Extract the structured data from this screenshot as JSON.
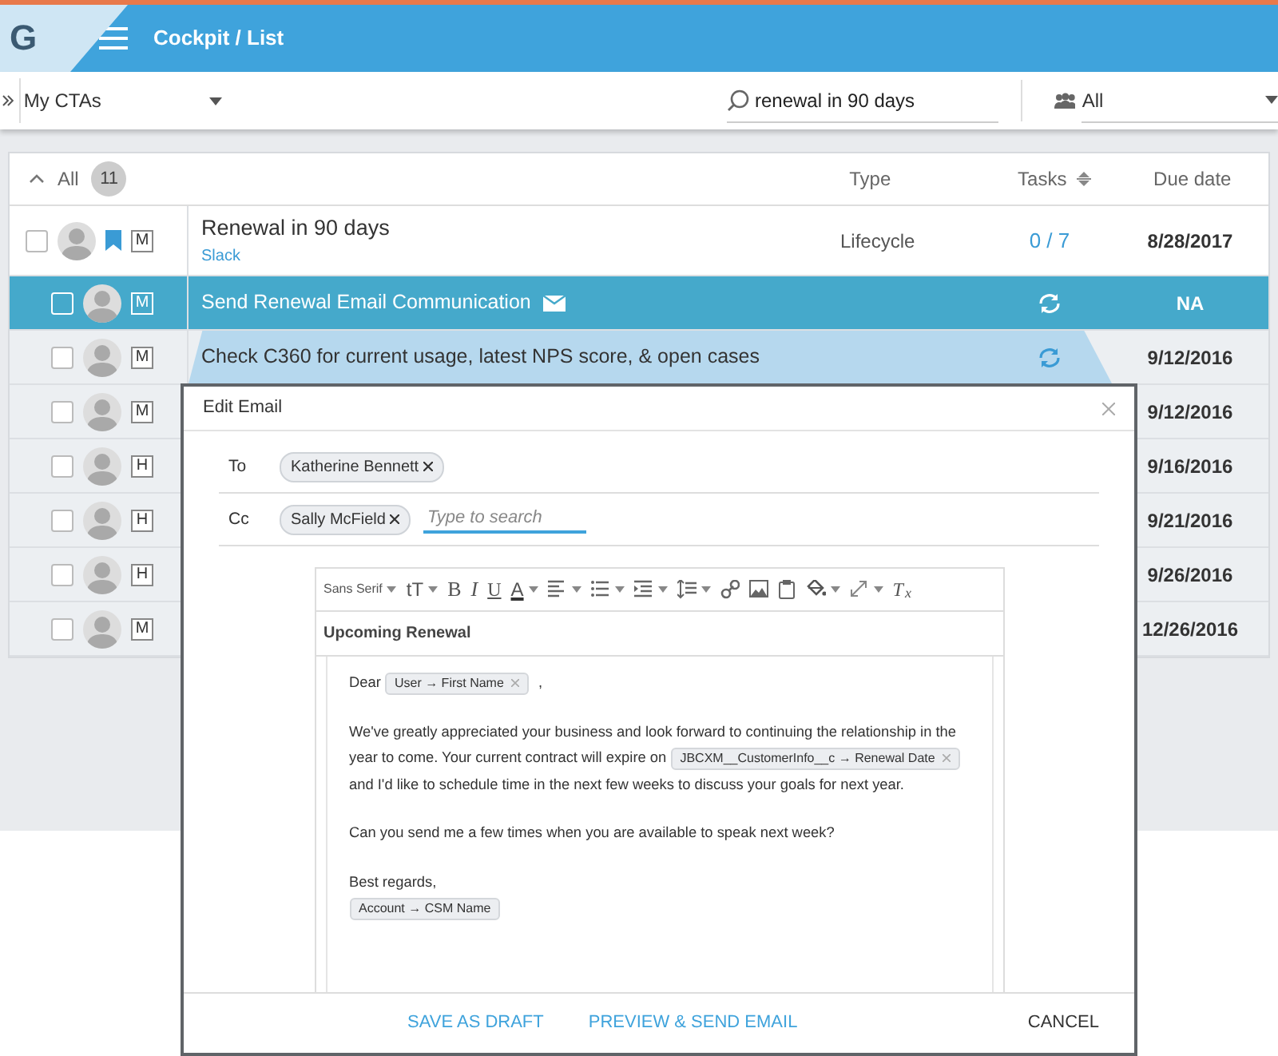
{
  "header": {
    "logo": "G",
    "breadcrumb": "Cockpit / List"
  },
  "filters": {
    "cta_select": "My CTAs",
    "search": "renewal in 90 days",
    "owner_select": "All"
  },
  "list": {
    "group_label": "All",
    "count": "11",
    "expanded": true,
    "columns": [
      "Type",
      "Tasks",
      "Due date"
    ],
    "rows": [
      {
        "kind": "cta",
        "title": "Renewal in 90 days",
        "subtitle": "Slack",
        "type": "Lifecycle",
        "tasks": "0 / 7",
        "due": "8/28/2017",
        "priority": "M",
        "checked": false,
        "bookmarked": true,
        "selected": false,
        "expanded": false,
        "email": false,
        "recurring": false
      },
      {
        "kind": "task",
        "title": "Send Renewal Email Communication",
        "due": "NA",
        "priority": "M",
        "checked": false,
        "bookmarked": false,
        "selected": true,
        "expanded": false,
        "email": true,
        "recurring": true
      },
      {
        "kind": "task",
        "title": "Check C360 for current usage, latest NPS score, & open cases",
        "due": "9/12/2016",
        "priority": "M",
        "checked": false,
        "bookmarked": false,
        "selected": false,
        "expanded": true,
        "email": false,
        "recurring": true
      },
      {
        "kind": "task",
        "due": "9/12/2016",
        "priority": "M",
        "checked": false,
        "bookmarked": false,
        "selected": false,
        "expanded": false,
        "email": false,
        "recurring": false
      },
      {
        "kind": "task",
        "due": "9/16/2016",
        "priority": "H",
        "checked": false,
        "bookmarked": false,
        "selected": false,
        "expanded": false,
        "email": false,
        "recurring": false
      },
      {
        "kind": "task",
        "due": "9/21/2016",
        "priority": "H",
        "checked": false,
        "bookmarked": false,
        "selected": false,
        "expanded": false,
        "email": false,
        "recurring": false
      },
      {
        "kind": "task",
        "due": "9/26/2016",
        "priority": "H",
        "checked": false,
        "bookmarked": false,
        "selected": false,
        "expanded": false,
        "email": false,
        "recurring": false
      },
      {
        "kind": "task",
        "due": "12/26/2016",
        "priority": "M",
        "checked": false,
        "bookmarked": false,
        "selected": false,
        "expanded": false,
        "email": false,
        "recurring": false
      }
    ]
  },
  "dialog": {
    "title": "Edit Email",
    "to": {
      "label": "To",
      "chips": [
        "Katherine Bennett"
      ]
    },
    "cc": {
      "label": "Cc",
      "chips": [
        "Sally McField"
      ],
      "placeholder": "Type to search"
    },
    "toolbar": [
      {
        "kind": "select",
        "label": "Sans Serif",
        "caret": true
      },
      {
        "kind": "textsize",
        "label": "tT",
        "caret": true
      },
      {
        "kind": "bold",
        "label": "B",
        "caret": false
      },
      {
        "kind": "italic",
        "label": "I",
        "caret": false
      },
      {
        "kind": "underline",
        "label": "U",
        "caret": false
      },
      {
        "kind": "fontcolor",
        "label": "A",
        "caret": true
      },
      {
        "kind": "align",
        "caret": true
      },
      {
        "kind": "list",
        "caret": true
      },
      {
        "kind": "indent",
        "caret": true
      },
      {
        "kind": "lineheight",
        "caret": true
      },
      {
        "kind": "link",
        "caret": false
      },
      {
        "kind": "image",
        "caret": false
      },
      {
        "kind": "paste",
        "caret": false
      },
      {
        "kind": "fill",
        "caret": true
      },
      {
        "kind": "expand",
        "caret": true
      },
      {
        "kind": "clear",
        "label": "T$_{x}$",
        "caret": false
      }
    ],
    "subject": "Upcoming Renewal",
    "body": [
      [
        {
          "kind": "text",
          "text": "Dear"
        },
        {
          "kind": "token",
          "text": "User → First Name",
          "removable": true
        },
        {
          "kind": "text",
          "text": ","
        }
      ],
      [
        {
          "kind": "text",
          "text": "We've greatly appreciated your business and look forward to continuing the relationship in the year to come. Your current contract will expire on"
        },
        {
          "kind": "token",
          "text": "JBCXM__CustomerInfo__c → Renewal Date",
          "removable": true
        },
        {
          "kind": "text",
          "text": "and I'd like to schedule time in the next few weeks to discuss your goals for next year."
        }
      ],
      [
        {
          "kind": "text",
          "text": "Can you send me a few times when you are available to speak next week?"
        }
      ],
      [
        {
          "kind": "text",
          "text": "Best regards,"
        },
        {
          "kind": "break"
        },
        {
          "kind": "token",
          "text": "Account →    CSM Name",
          "removable": false
        }
      ]
    ],
    "buttons": [
      {
        "label": "SAVE AS DRAFT",
        "kind": "link"
      },
      {
        "label": "PREVIEW & SEND EMAIL",
        "kind": "link"
      },
      {
        "label": "CANCEL",
        "kind": "plain"
      }
    ]
  }
}
